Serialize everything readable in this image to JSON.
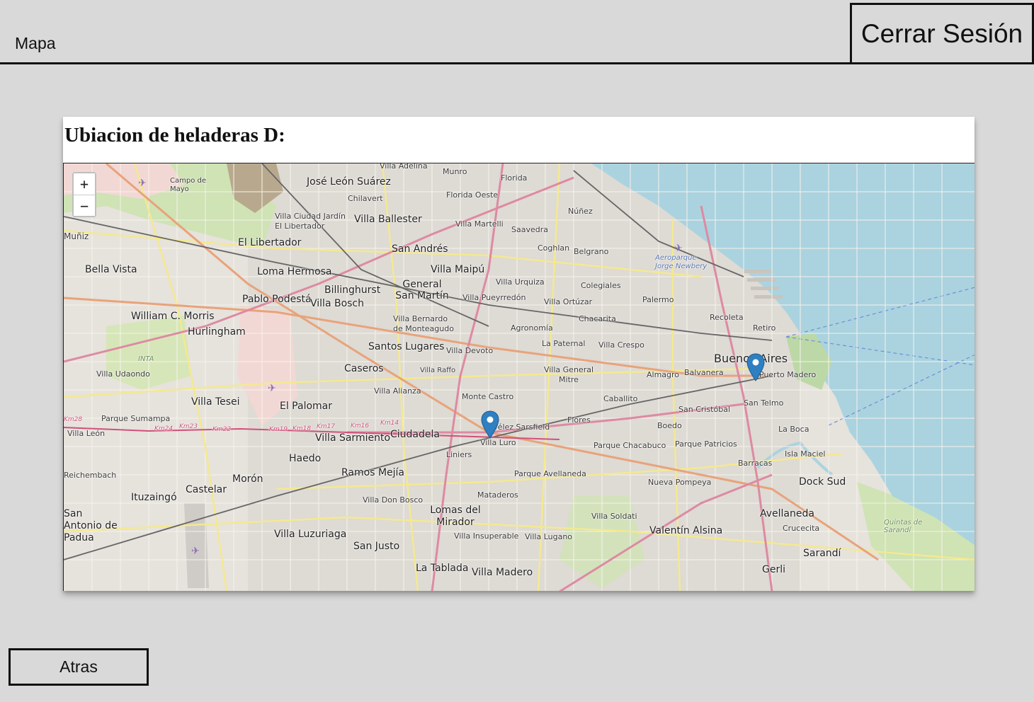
{
  "header": {
    "title": "Mapa",
    "logout_label": "Cerrar Sesión"
  },
  "card": {
    "title": "Ubiacion de heladeras D:"
  },
  "map": {
    "zoom_in": "+",
    "zoom_out": "−",
    "marker_color": "#2f7fc1",
    "water_color": "#aad3df",
    "labels": [
      "Villa Adelina",
      "Munro",
      "Florida",
      "José León Suárez",
      "Chilavert",
      "Florida Oeste",
      "Campo de Mayo",
      "Villa Ciudad Jardín El Libertador",
      "Villa Ballester",
      "Villa Martelli",
      "Núñez",
      "Saavedra",
      "Muñiz",
      "El Libertador",
      "San Andrés",
      "Coghlan",
      "Belgrano",
      "Aeroparque Jorge Newbery",
      "Bella Vista",
      "Loma Hermosa",
      "Villa Maipú",
      "Billinghurst",
      "General San Martín",
      "Villa Urquiza",
      "Colegiales",
      "Pablo Podestá",
      "Villa Bosch",
      "Villa Pueyrredón",
      "Villa Ortúzar",
      "Palermo",
      "William C. Morris",
      "Villa Bernardo de Monteagudo",
      "Chacarita",
      "Recoleta",
      "Retiro",
      "Hurlingham",
      "Agronomía",
      "La Paternal",
      "Villa Crespo",
      "Santos Lugares",
      "Villa Devoto",
      "Buenos Aires",
      "Puerto Madero",
      "Caseros",
      "Villa Raffo",
      "Villa General Mitre",
      "Almagro",
      "Balvanera",
      "Villa Udaondo",
      "Villa Alianza",
      "Monte Castro",
      "Caballito",
      "San Telmo",
      "San Cristóbal",
      "El Palomar",
      "Villa Tesei",
      "Parque Sumampa",
      "Vélez Sarsfield",
      "Flores",
      "Boedo",
      "La Boca",
      "Villa León",
      "Villa Sarmiento",
      "Ciudadela",
      "Villa Luro",
      "Parque Chacabuco",
      "Parque Patricios",
      "Isla Maciel",
      "Haedo",
      "Liniers",
      "Barracas",
      "Reichembach",
      "Ramos Mejía",
      "Morón",
      "Parque Avellaneda",
      "Nueva Pompeya",
      "Dock Sud",
      "Ituzaingó",
      "Castelar",
      "Villa Don Bosco",
      "Mataderos",
      "Villa Soldati",
      "Avellaneda",
      "San Antonio de Padua",
      "Lomas del Mirador",
      "Valentín Alsina",
      "Crucecita",
      "Villa Luzuriaga",
      "Villa Insuperable",
      "Villa Lugano",
      "San Justo",
      "Sarandí",
      "La Tablada",
      "Villa Madero",
      "Gerli",
      "Quintas de Sarandí",
      "INTA",
      "Km24",
      "Km23",
      "Km22",
      "Km19",
      "Km18",
      "Km17",
      "Km16",
      "Km14",
      "Km28"
    ]
  },
  "footer": {
    "back_label": "Atras"
  }
}
